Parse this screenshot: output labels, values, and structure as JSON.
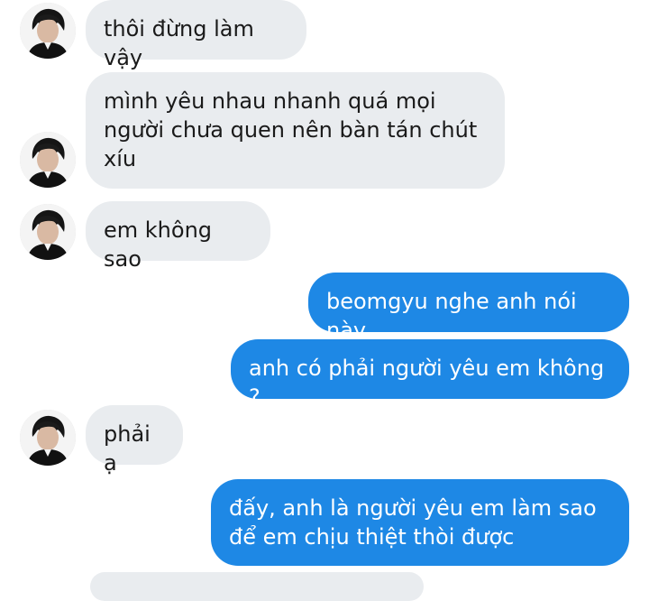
{
  "chat": {
    "messages": [
      {
        "direction": "incoming",
        "text": "thôi đừng làm vậy",
        "has_avatar": true
      },
      {
        "direction": "incoming",
        "text": "mình yêu nhau nhanh quá mọi\nngười chưa quen nên bàn tán chút\nxíu",
        "has_avatar": true
      },
      {
        "direction": "incoming",
        "text": "em không sao",
        "has_avatar": true
      },
      {
        "direction": "outgoing",
        "text": "beomgyu nghe anh nói này"
      },
      {
        "direction": "outgoing",
        "text": "anh có phải người yêu em không ?"
      },
      {
        "direction": "incoming",
        "text": "phải ạ",
        "has_avatar": true
      },
      {
        "direction": "outgoing",
        "text": "đấy, anh là người yêu em làm sao\nđể em chịu thiệt thòi được"
      }
    ]
  },
  "colors": {
    "incoming_bubble": "#e9ecef",
    "outgoing_bubble": "#1e88e5",
    "incoming_text": "#1a1a1a",
    "outgoing_text": "#ffffff"
  },
  "icons": {
    "avatar": "contact-avatar-photo"
  }
}
